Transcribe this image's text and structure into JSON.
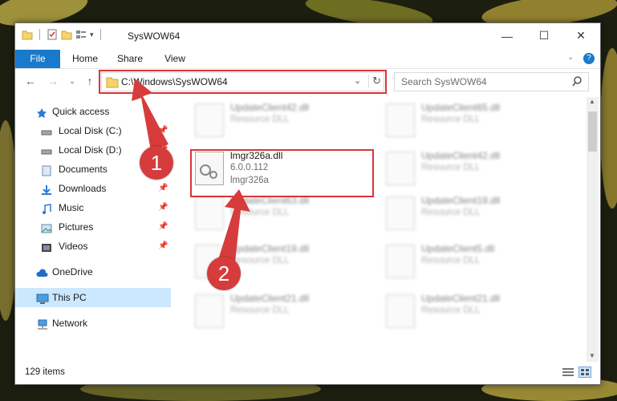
{
  "window": {
    "title": "SysWOW64",
    "controls": {
      "minimize": "—",
      "maximize": "☐",
      "close": "✕"
    }
  },
  "ribbon": {
    "tabs": [
      "File",
      "Home",
      "Share",
      "View"
    ]
  },
  "address_bar": {
    "path": "C:\\Windows\\SysWOW64",
    "search_placeholder": "Search SysWOW64"
  },
  "nav_pane": {
    "items": [
      {
        "label": "Quick access",
        "icon": "star-icon"
      },
      {
        "label": "Local Disk (C:)",
        "icon": "drive-icon",
        "pinned": true
      },
      {
        "label": "Local Disk (D:)",
        "icon": "drive-icon",
        "pinned": true
      },
      {
        "label": "Documents",
        "icon": "documents-icon",
        "pinned": true
      },
      {
        "label": "Downloads",
        "icon": "download-icon",
        "pinned": true
      },
      {
        "label": "Music",
        "icon": "music-icon",
        "pinned": true
      },
      {
        "label": "Pictures",
        "icon": "pictures-icon",
        "pinned": true
      },
      {
        "label": "Videos",
        "icon": "videos-icon",
        "pinned": true
      },
      {
        "label": "OneDrive",
        "icon": "cloud-icon"
      },
      {
        "label": "This PC",
        "icon": "pc-icon",
        "selected": true
      },
      {
        "label": "Network",
        "icon": "network-icon"
      }
    ]
  },
  "files": {
    "highlighted": {
      "name": "lmgr326a.dll",
      "version": "6.0.0.112",
      "description": "lmgr326a"
    },
    "blurred": [
      {
        "name": "UpdateClient42.dll",
        "type": "Resource DLL"
      },
      {
        "name": "UpdateClient65.dll",
        "type": "Resource DLL"
      },
      {
        "name": "UpdateClient42.dll",
        "type": "Resource DLL"
      },
      {
        "name": "UpdateClient63.dll",
        "type": "Resource DLL"
      },
      {
        "name": "UpdateClient19.dll",
        "type": "Resource DLL"
      },
      {
        "name": "UpdateClient19.dll",
        "type": "Resource DLL"
      },
      {
        "name": "UpdateClient5.dll",
        "type": "Resource DLL"
      },
      {
        "name": "UpdateClient21.dll",
        "type": "Resource DLL"
      },
      {
        "name": "UpdateClient21.dll",
        "type": "Resource DLL"
      }
    ]
  },
  "status_bar": {
    "item_count": "129 items"
  },
  "annotations": {
    "step1": "1",
    "step2": "2"
  },
  "colors": {
    "accent": "#1979ca",
    "highlight": "#d9343a",
    "selected": "#cce8ff"
  }
}
